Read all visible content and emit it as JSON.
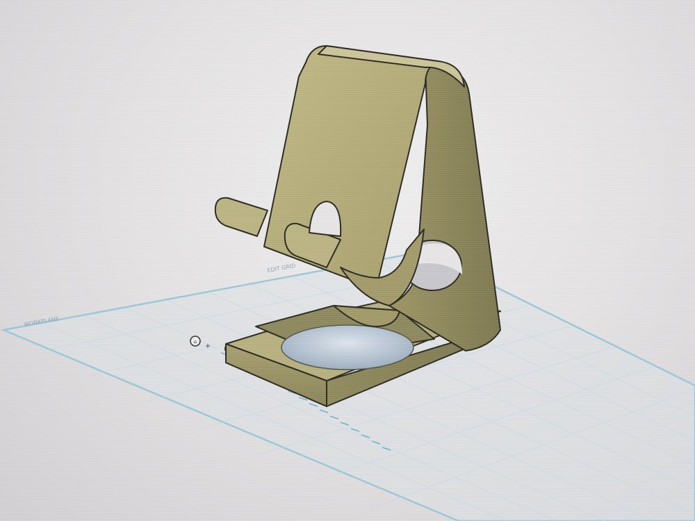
{
  "workplane": {
    "label_left": "WORKPLANE",
    "label_top": "EDIT GRID",
    "grid_color": "#9cc9dc",
    "grid_line_color": "#c7dbe4"
  },
  "model": {
    "name": "phone-stand",
    "color": "#b6ae7c",
    "shadow_color": "#7f7a52",
    "edge_color": "#2b2b22",
    "hole_fill": "#c9d3df"
  },
  "view_controls": {
    "home_icon": "home-icon",
    "zoom_icon": "plus-icon",
    "ruler_origin_icon": "ring-icon"
  }
}
